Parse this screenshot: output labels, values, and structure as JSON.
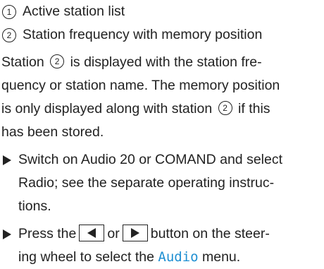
{
  "legend": [
    {
      "number": "1",
      "text": "Active station list"
    },
    {
      "number": "2",
      "text": "Station frequency with memory position"
    }
  ],
  "paragraph": {
    "line1_before": "Station",
    "line1_ref": "2",
    "line1_after": "is displayed with the station fre-",
    "line2": "quency or station name. The memory position",
    "line3_before": "is only displayed along with station",
    "line3_ref": "2",
    "line3_after": "if this",
    "line4": "has been stored."
  },
  "steps": [
    {
      "lines": [
        "Switch on Audio 20 or COMAND and select",
        "Radio; see the separate operating instruc-",
        "tions."
      ]
    },
    {
      "text_press": "Press the",
      "button_left_icon": "left-arrow-icon",
      "text_or": "or",
      "button_right_icon": "right-arrow-icon",
      "text_after": "button on the steer-",
      "line2_before": "ing wheel to select the",
      "menu_name": "Audio",
      "line2_after": "menu."
    }
  ],
  "colors": {
    "text": "#222222",
    "menu_highlight": "#1e8fd2"
  }
}
